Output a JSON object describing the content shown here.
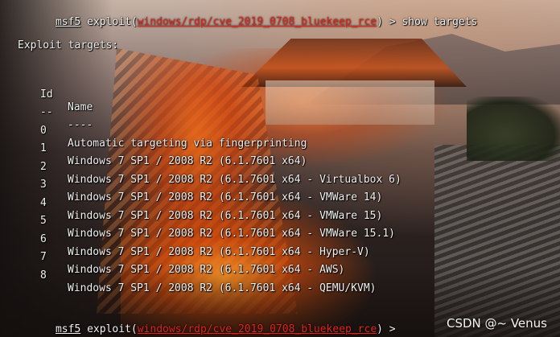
{
  "prompt_top": {
    "prefix": "msf5",
    "cmd": " exploit(",
    "module": "windows/rdp/cve_2019_0708_bluekeep_rce",
    "suffix": ") > show targets"
  },
  "section_title": "Exploit targets:",
  "table": {
    "headers": {
      "id": "Id",
      "name": "Name"
    },
    "separators": {
      "id": "--",
      "name": "----"
    },
    "rows": [
      {
        "id": "0",
        "name": "Automatic targeting via fingerprinting"
      },
      {
        "id": "1",
        "name": "Windows 7 SP1 / 2008 R2 (6.1.7601 x64)"
      },
      {
        "id": "2",
        "name": "Windows 7 SP1 / 2008 R2 (6.1.7601 x64 - Virtualbox 6)"
      },
      {
        "id": "3",
        "name": "Windows 7 SP1 / 2008 R2 (6.1.7601 x64 - VMWare 14)"
      },
      {
        "id": "4",
        "name": "Windows 7 SP1 / 2008 R2 (6.1.7601 x64 - VMWare 15)"
      },
      {
        "id": "5",
        "name": "Windows 7 SP1 / 2008 R2 (6.1.7601 x64 - VMWare 15.1)"
      },
      {
        "id": "6",
        "name": "Windows 7 SP1 / 2008 R2 (6.1.7601 x64 - Hyper-V)"
      },
      {
        "id": "7",
        "name": "Windows 7 SP1 / 2008 R2 (6.1.7601 x64 - AWS)"
      },
      {
        "id": "8",
        "name": "Windows 7 SP1 / 2008 R2 (6.1.7601 x64 - QEMU/KVM)"
      }
    ]
  },
  "prompt_bottom": {
    "prefix": "msf5",
    "cmd": " exploit(",
    "module": "windows/rdp/cve_2019_0708_bluekeep_rce",
    "suffix": ") > "
  },
  "watermark": "CSDN @~ Venus",
  "colors": {
    "module_text": "#e0231b",
    "terminal_text": "#f2f2f2"
  }
}
